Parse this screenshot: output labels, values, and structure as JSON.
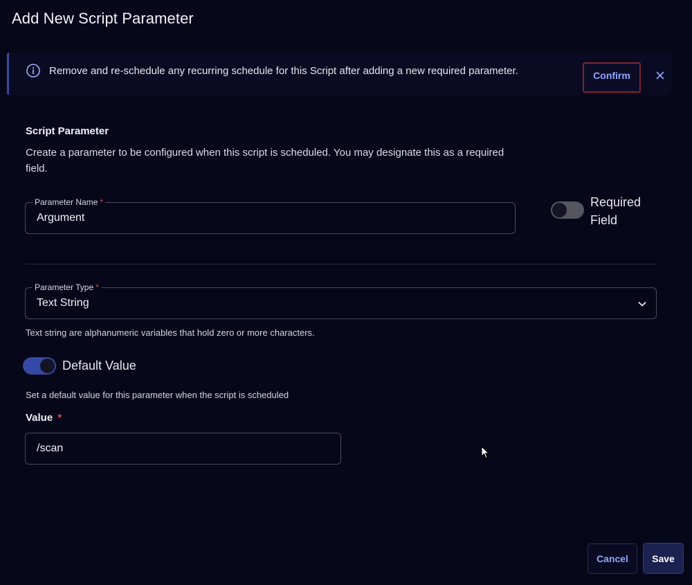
{
  "dialog": {
    "title": "Add New Script Parameter"
  },
  "alert": {
    "icon": "info-icon",
    "message": "Remove and re-schedule any recurring schedule for this Script after adding a new required parameter.",
    "confirm_label": "Confirm",
    "close_icon": "close-icon"
  },
  "section": {
    "title": "Script Parameter",
    "description": "Create a parameter to be configured when this script is scheduled. You may designate this as a required field."
  },
  "parameter_name": {
    "label": "Parameter Name",
    "required_mark": "*",
    "value": "Argument"
  },
  "required_field": {
    "label": "Required Field",
    "enabled": false
  },
  "parameter_type": {
    "label": "Parameter Type",
    "required_mark": "*",
    "selected": "Text String",
    "helper": "Text string are alphanumeric variables that hold zero or more characters.",
    "icon": "chevron-down-icon"
  },
  "default_value": {
    "toggle_label": "Default Value",
    "enabled": true,
    "description": "Set a default value for this parameter when the script is scheduled",
    "value_label": "Value",
    "required_mark": "*",
    "value": "/scan"
  },
  "footer": {
    "cancel_label": "Cancel",
    "save_label": "Save"
  },
  "colors": {
    "background": "#07071a",
    "accent": "#8fa6ff",
    "toggle_on": "#3549a6",
    "required": "#e0463f"
  }
}
